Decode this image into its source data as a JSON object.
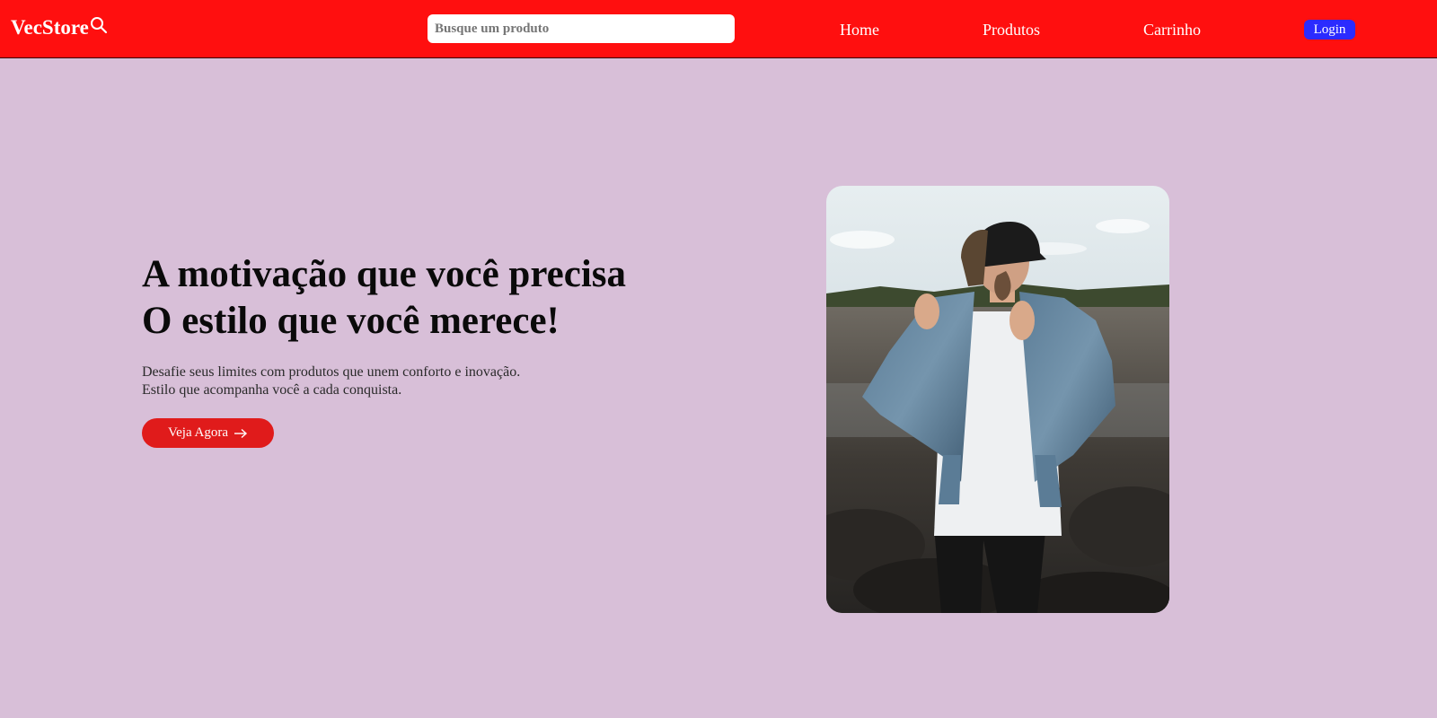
{
  "navbar": {
    "brand": "VecStore",
    "search_placeholder": "Busque um produto",
    "links": [
      {
        "label": "Home"
      },
      {
        "label": "Produtos"
      },
      {
        "label": "Carrinho"
      }
    ],
    "login_label": "Login",
    "background_color": "#ff0f0f",
    "login_color": "#2b2bff"
  },
  "hero": {
    "title_line1": "A motivação que você precisa",
    "title_line2": "O estilo que você merece!",
    "description_line1": "Desafie seus limites com produtos que unem conforto e inovação.",
    "description_line2": "Estilo que acompanha você a cada conquista.",
    "cta_label": "Veja Agora",
    "cta_icon": "arrow-right-icon",
    "cta_color": "#e01b1b",
    "background_color": "#d8bfd8"
  },
  "icons": {
    "brand": "search-icon",
    "cta": "arrow-right-icon"
  }
}
